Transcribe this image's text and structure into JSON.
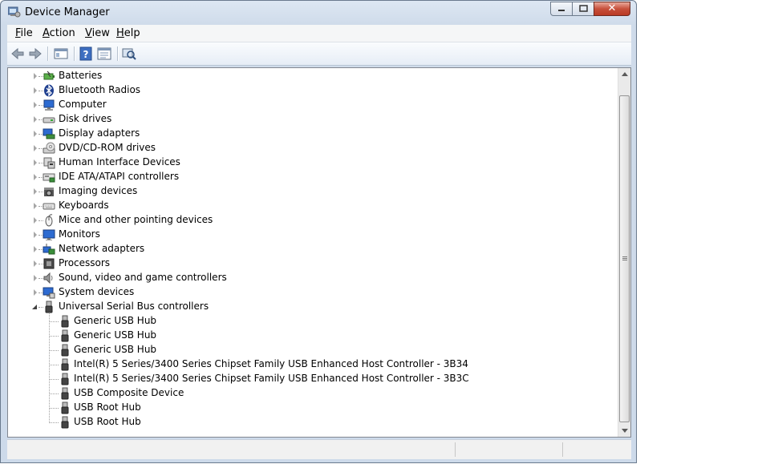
{
  "window": {
    "title": "Device Manager"
  },
  "menu": {
    "items": [
      "File",
      "Action",
      "View",
      "Help"
    ]
  },
  "toolbar": {
    "buttons": [
      "back-icon",
      "forward-icon",
      "console-tree-icon",
      "help-icon",
      "properties-icon",
      "scan-hardware-icon"
    ]
  },
  "tree": {
    "categories": [
      {
        "label": "Batteries",
        "icon": "battery-icon"
      },
      {
        "label": "Bluetooth Radios",
        "icon": "bluetooth-icon"
      },
      {
        "label": "Computer",
        "icon": "computer-icon"
      },
      {
        "label": "Disk drives",
        "icon": "disk-drive-icon"
      },
      {
        "label": "Display adapters",
        "icon": "display-adapter-icon"
      },
      {
        "label": "DVD/CD-ROM drives",
        "icon": "dvd-drive-icon"
      },
      {
        "label": "Human Interface Devices",
        "icon": "hid-icon"
      },
      {
        "label": "IDE ATA/ATAPI controllers",
        "icon": "ide-controller-icon"
      },
      {
        "label": "Imaging devices",
        "icon": "camera-icon"
      },
      {
        "label": "Keyboards",
        "icon": "keyboard-icon"
      },
      {
        "label": "Mice and other pointing devices",
        "icon": "mouse-icon"
      },
      {
        "label": "Monitors",
        "icon": "monitor-icon"
      },
      {
        "label": "Network adapters",
        "icon": "network-adapter-icon"
      },
      {
        "label": "Processors",
        "icon": "processor-icon"
      },
      {
        "label": "Sound, video and game controllers",
        "icon": "speaker-icon"
      },
      {
        "label": "System devices",
        "icon": "system-devices-icon"
      }
    ],
    "expanded_category": {
      "label": "Universal Serial Bus controllers",
      "icon": "usb-icon",
      "children": [
        "Generic USB Hub",
        "Generic USB Hub",
        "Generic USB Hub",
        "Intel(R) 5 Series/3400 Series Chipset Family USB Enhanced Host Controller - 3B34",
        "Intel(R) 5 Series/3400 Series Chipset Family USB Enhanced Host Controller - 3B3C",
        "USB Composite Device",
        "USB Root Hub",
        "USB Root Hub"
      ]
    }
  }
}
